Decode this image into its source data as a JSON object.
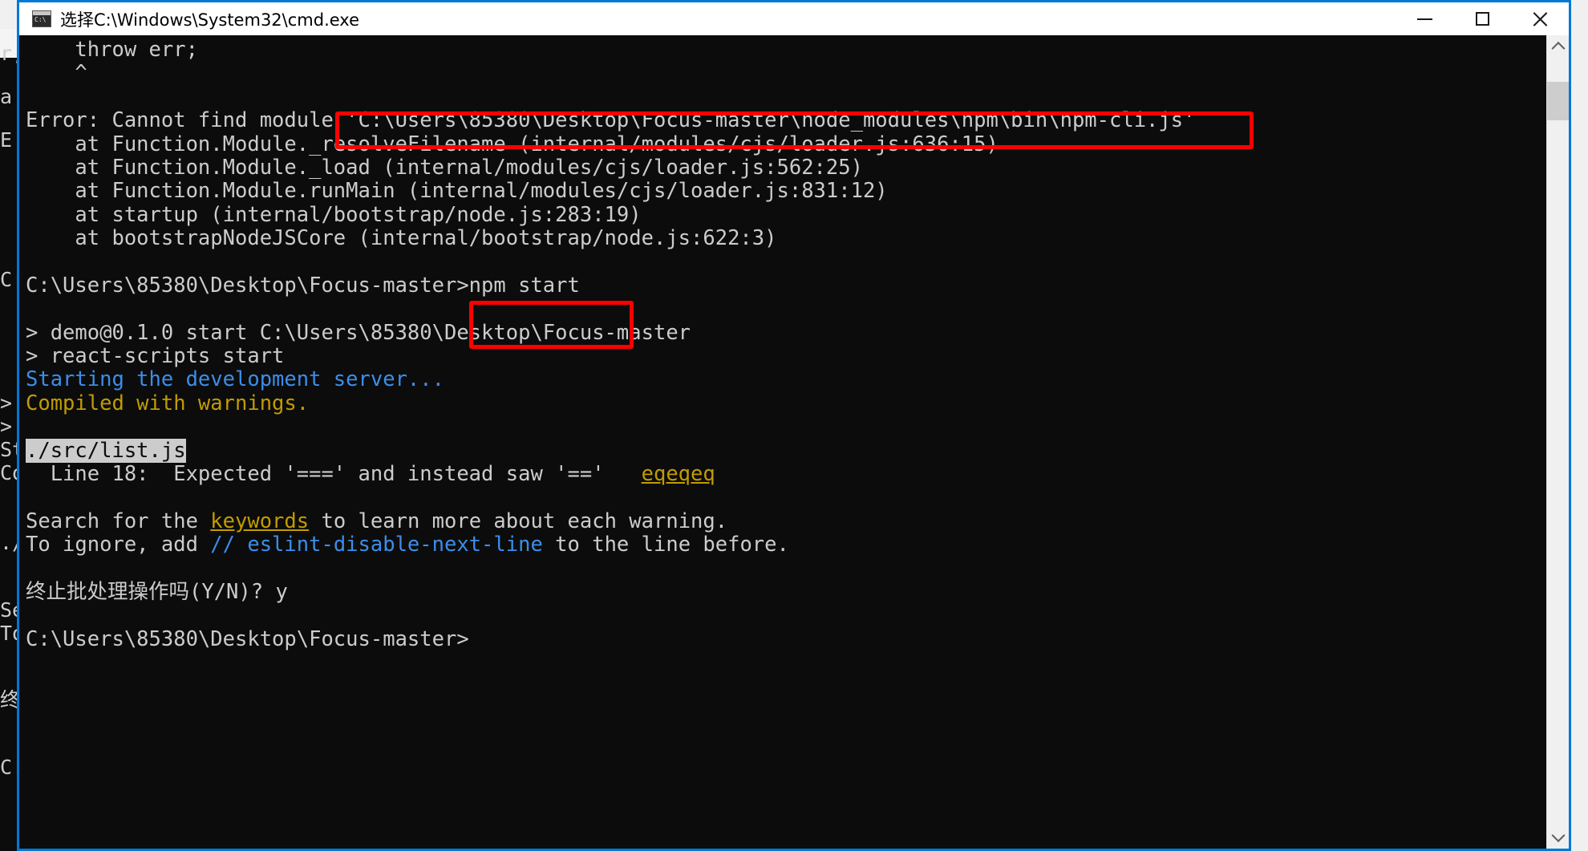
{
  "window": {
    "title": "选择C:\\Windows\\System32\\cmd.exe",
    "icon": "cmd-console-icon",
    "border_color": "#0078d7",
    "titlebar_bg": "#ffffff",
    "console_bg": "#0c0c0c",
    "controls": {
      "minimize": "—",
      "maximize": "□",
      "close": "✕"
    }
  },
  "background_window": {
    "visible_fragments": [
      "r;",
      "a",
      "E",
      "C:",
      ">",
      ">",
      "St",
      "Co",
      "./",
      "Se",
      "To",
      "终",
      "C:"
    ]
  },
  "console": {
    "lines": [
      {
        "id": "throw-err",
        "segments": [
          {
            "text": "    throw err;",
            "color": "#cccccc"
          }
        ]
      },
      {
        "id": "caret",
        "segments": [
          {
            "text": "    ^",
            "color": "#cccccc"
          }
        ]
      },
      {
        "id": "blank-1",
        "segments": [
          {
            "text": "",
            "color": "#cccccc"
          }
        ]
      },
      {
        "id": "error-module",
        "segments": [
          {
            "text": "Error: Cannot find module 'C:\\Users\\85380\\Desktop\\Focus-master\\node_modules\\npm\\bin\\npm-cli.js'",
            "color": "#cccccc"
          }
        ]
      },
      {
        "id": "stack-resolvefilename",
        "segments": [
          {
            "text": "    at Function.Module._resolveFilename (internal/modules/cjs/loader.js:636:15)",
            "color": "#cccccc"
          }
        ]
      },
      {
        "id": "stack-load",
        "segments": [
          {
            "text": "    at Function.Module._load (internal/modules/cjs/loader.js:562:25)",
            "color": "#cccccc"
          }
        ]
      },
      {
        "id": "stack-runmain",
        "segments": [
          {
            "text": "    at Function.Module.runMain (internal/modules/cjs/loader.js:831:12)",
            "color": "#cccccc"
          }
        ]
      },
      {
        "id": "stack-startup",
        "segments": [
          {
            "text": "    at startup (internal/bootstrap/node.js:283:19)",
            "color": "#cccccc"
          }
        ]
      },
      {
        "id": "stack-bootstrap",
        "segments": [
          {
            "text": "    at bootstrapNodeJSCore (internal/bootstrap/node.js:622:3)",
            "color": "#cccccc"
          }
        ]
      },
      {
        "id": "blank-2",
        "segments": [
          {
            "text": "",
            "color": "#cccccc"
          }
        ]
      },
      {
        "id": "prompt-npm-start",
        "segments": [
          {
            "text": "C:\\Users\\85380\\Desktop\\Focus-master>npm start",
            "color": "#cccccc"
          }
        ]
      },
      {
        "id": "blank-3",
        "segments": [
          {
            "text": "",
            "color": "#cccccc"
          }
        ]
      },
      {
        "id": "npm-pkg",
        "segments": [
          {
            "text": "> demo@0.1.0 start C:\\Users\\85380\\Desktop\\Focus-master",
            "color": "#cccccc"
          }
        ]
      },
      {
        "id": "npm-script",
        "segments": [
          {
            "text": "> react-scripts start",
            "color": "#cccccc"
          }
        ]
      },
      {
        "id": "dev-server",
        "segments": [
          {
            "text": "Starting the development server...",
            "color": "#3b8eea"
          }
        ]
      },
      {
        "id": "compiled-warnings",
        "segments": [
          {
            "text": "Compiled with warnings.",
            "color": "#c19c00"
          }
        ]
      },
      {
        "id": "blank-4",
        "segments": [
          {
            "text": "",
            "color": "#cccccc"
          }
        ]
      },
      {
        "id": "file-listjs",
        "segments": [
          {
            "text": "./src/list.js",
            "color": "#0c0c0c",
            "bg": "#cccccc"
          }
        ]
      },
      {
        "id": "warning-eqeqeq",
        "segments": [
          {
            "text": "  Line 18:  Expected '===' and instead saw '=='   ",
            "color": "#cccccc"
          },
          {
            "text": "eqeqeq",
            "color": "#c19c00",
            "underline": true
          }
        ]
      },
      {
        "id": "blank-5",
        "segments": [
          {
            "text": "",
            "color": "#cccccc"
          }
        ]
      },
      {
        "id": "search-keywords",
        "segments": [
          {
            "text": "Search for the ",
            "color": "#cccccc"
          },
          {
            "text": "keywords",
            "color": "#c19c00",
            "underline": true
          },
          {
            "text": " to learn more about each warning.",
            "color": "#cccccc"
          }
        ]
      },
      {
        "id": "to-ignore",
        "segments": [
          {
            "text": "To ignore, add ",
            "color": "#cccccc"
          },
          {
            "text": "// eslint-disable-next-line",
            "color": "#3b8eea"
          },
          {
            "text": " to the line before.",
            "color": "#cccccc"
          }
        ]
      },
      {
        "id": "blank-6",
        "segments": [
          {
            "text": "",
            "color": "#cccccc"
          }
        ]
      },
      {
        "id": "terminate-batch",
        "segments": [
          {
            "text": "终止批处理操作吗(Y/N)? y",
            "color": "#cccccc"
          }
        ]
      },
      {
        "id": "blank-7",
        "segments": [
          {
            "text": "",
            "color": "#cccccc"
          }
        ]
      },
      {
        "id": "prompt-final",
        "segments": [
          {
            "text": "C:\\Users\\85380\\Desktop\\Focus-master>",
            "color": "#cccccc"
          }
        ]
      }
    ]
  },
  "annotations": [
    {
      "id": "annot-module-path",
      "target": "'C:\\Users\\85380\\Desktop\\Focus-master\\node_modules\\npm\\bin\\npm-cli.js'",
      "color": "#fe0000"
    },
    {
      "id": "annot-npm-start",
      "target": ">npm start",
      "color": "#fe0000"
    }
  ],
  "scrollbar": {
    "up_arrow": "chevron-up",
    "down_arrow": "chevron-down",
    "thumb_position_percent": 3
  }
}
